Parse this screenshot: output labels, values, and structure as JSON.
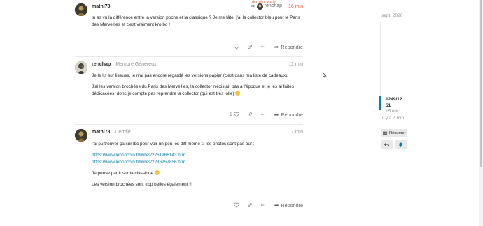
{
  "top_flag": "dernière visite",
  "posts": [
    {
      "username": "mathi78",
      "user_title": "",
      "reply_to": "renchap",
      "date": "16 min",
      "paragraphs": [
        "tu as vu la différence entre la version poche et la classique ? Je me tâte, j'ai la collector bleu pour le Paris des Merveilles et c'est vraiment kro bo !"
      ],
      "like_count": "",
      "reply_label": "Répondre"
    },
    {
      "username": "renchap",
      "user_title": "Membre Généreux",
      "date": "11 min",
      "paragraphs": [
        "Je le lis sur liseuse, je n'ai pas encore regardé les versions papier (c'est dans ma liste de cadeaux).",
        "J'ai les version brochées du Paris des Merveilles, la collector n'existait pas à l'époque et je les ai faites dédicacées, donc je compte pas reprendre la collector (qui est très jolie)"
      ],
      "like_count": "1",
      "reply_label": "Répondre"
    },
    {
      "username": "mathi78",
      "user_title": "Certifié",
      "date": "7 min",
      "paragraphs": [
        "j'ai pu trouver ça sur lbc pour voir un peu les diff même si les photos sont pas ouf :"
      ],
      "links": [
        "https://www.leboncoin.fr/livres/2261966143.htm",
        "https://www.leboncoin.fr/livres/2236257856.htm"
      ],
      "paragraphs_after": [
        "Je pense partir sur la classique",
        "Les version brochées sont trop belles également !!!"
      ],
      "like_count": "",
      "reply_label": "Répondre"
    }
  ],
  "timeline": {
    "date_top": "sept. 2020",
    "count_line1": "1249/12",
    "count_line2": "51",
    "date": "15 déc.",
    "ago": "il y a 7 min",
    "summary_label": "Résumer"
  },
  "colors": {
    "accent": "#0a7da8",
    "muted": "#919191",
    "new_marker": "#e45735"
  }
}
